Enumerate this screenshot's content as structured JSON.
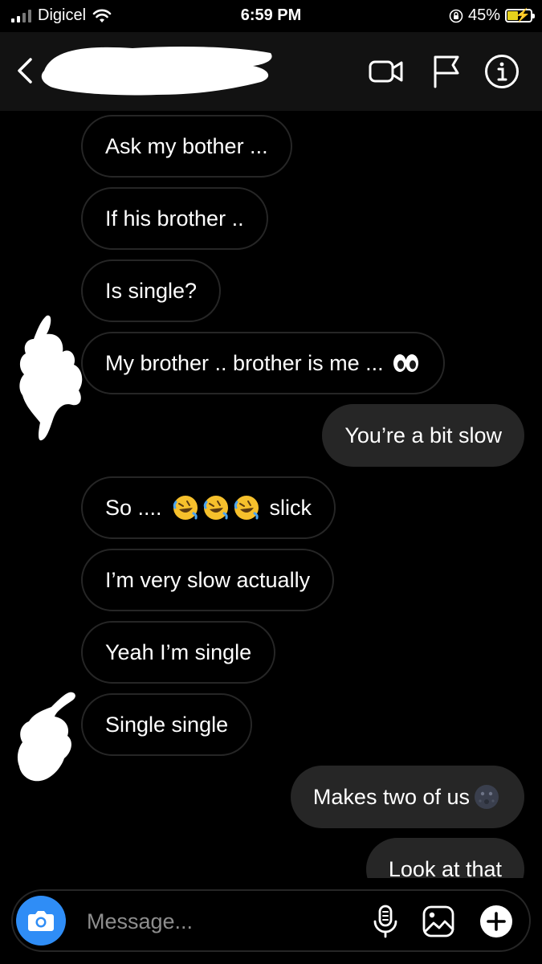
{
  "status_bar": {
    "carrier": "Digicel",
    "time": "6:59 PM",
    "battery": "45%",
    "battery_level": 0.45
  },
  "header": {
    "contact_name_redacted": true,
    "icons": [
      "back-chevron-icon",
      "video-call-icon",
      "flag-icon",
      "info-icon"
    ]
  },
  "messages": [
    {
      "dir": "in",
      "text": "Ask my bother ..."
    },
    {
      "dir": "in",
      "text": "If his brother .."
    },
    {
      "dir": "in",
      "text": "Is single?"
    },
    {
      "dir": "in",
      "text": "My brother .. brother is me ...",
      "emoji": "eyes"
    },
    {
      "dir": "out",
      "text": "You’re a bit slow"
    },
    {
      "dir": "in",
      "text_before": "So ....",
      "text_after": "slick",
      "emoji": "rofl x3"
    },
    {
      "dir": "in",
      "text": "I’m very slow actually"
    },
    {
      "dir": "in",
      "text": "Yeah I’m single"
    },
    {
      "dir": "in",
      "text": "Single single"
    },
    {
      "dir": "out",
      "text": "Makes two of us",
      "emoji": "new-moon-face"
    },
    {
      "dir": "out",
      "text": "Look at that"
    }
  ],
  "composer": {
    "placeholder": "Message...",
    "icons": [
      "camera-icon",
      "microphone-icon",
      "gallery-icon",
      "plus-icon"
    ]
  },
  "colors": {
    "background": "#000000",
    "header": "#121212",
    "outgoing_bubble": "#262626",
    "incoming_border": "#262626",
    "camera_button": "#2f8df6",
    "placeholder": "#8e8e8e"
  }
}
